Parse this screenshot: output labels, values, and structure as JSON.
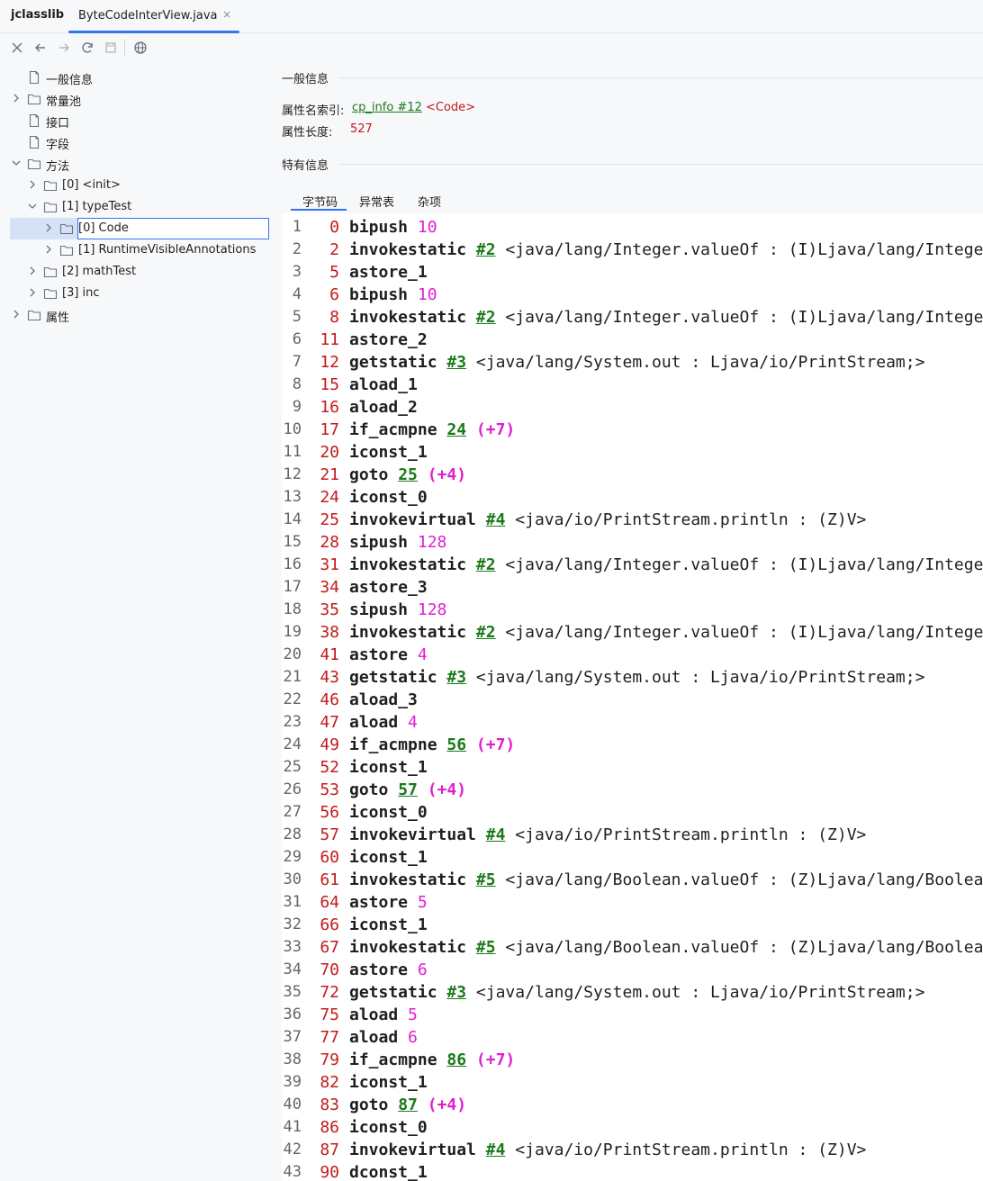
{
  "tabbar": {
    "tool_title": "jclasslib",
    "file_tab": "ByteCodeInterView.java",
    "close_glyph": "×"
  },
  "toolbar": {
    "icons": [
      "close-icon",
      "back-icon",
      "forward-icon",
      "refresh-icon",
      "save-icon",
      "web-icon"
    ]
  },
  "tree": [
    {
      "label": "一般信息",
      "expandable": false,
      "expanded": false,
      "icon": "file-icon",
      "level": 0
    },
    {
      "label": "常量池",
      "expandable": true,
      "expanded": false,
      "icon": "folder-icon",
      "level": 0
    },
    {
      "label": "接口",
      "expandable": false,
      "expanded": false,
      "icon": "file-icon",
      "level": 0
    },
    {
      "label": "字段",
      "expandable": false,
      "expanded": false,
      "icon": "file-icon",
      "level": 0
    },
    {
      "label": "方法",
      "expandable": true,
      "expanded": true,
      "icon": "folder-icon",
      "level": 0
    },
    {
      "label": "[0] <init>",
      "expandable": true,
      "expanded": false,
      "icon": "folder-icon",
      "level": 1
    },
    {
      "label": "[1] typeTest",
      "expandable": true,
      "expanded": true,
      "icon": "folder-icon",
      "level": 1
    },
    {
      "label": "[0] Code",
      "expandable": true,
      "expanded": false,
      "icon": "folder-icon",
      "level": 2,
      "selected": true
    },
    {
      "label": "[1] RuntimeVisibleAnnotations",
      "expandable": true,
      "expanded": false,
      "icon": "folder-icon",
      "level": 2
    },
    {
      "label": "[2] mathTest",
      "expandable": true,
      "expanded": false,
      "icon": "folder-icon",
      "level": 1
    },
    {
      "label": "[3] inc",
      "expandable": true,
      "expanded": false,
      "icon": "folder-icon",
      "level": 1
    },
    {
      "label": "属性",
      "expandable": true,
      "expanded": false,
      "icon": "folder-icon",
      "level": 0
    }
  ],
  "general": {
    "heading": "一般信息",
    "attr_name_index_label": "属性名索引:",
    "attr_name_index_link": "cp_info #12",
    "attr_name_index_value": "<Code>",
    "attr_length_label": "属性长度:",
    "attr_length_value": "527"
  },
  "specific": {
    "heading": "特有信息",
    "tabs": [
      "字节码",
      "异常表",
      "杂项"
    ],
    "active_tab": 0
  },
  "colors": {
    "accent": "#3574f0",
    "offset": "#c41a1a",
    "constant": "#e020d0",
    "reference": "#1a7a1a"
  },
  "bytecode": [
    {
      "ln": "1",
      "off": "0",
      "op": "bipush",
      "num": "10"
    },
    {
      "ln": "2",
      "off": "2",
      "op": "invokestatic",
      "ref": "#2",
      "cmt": "<java/lang/Integer.valueOf : (I)Ljava/lang/Integer;>"
    },
    {
      "ln": "3",
      "off": "5",
      "op": "astore_1"
    },
    {
      "ln": "4",
      "off": "6",
      "op": "bipush",
      "num": "10"
    },
    {
      "ln": "5",
      "off": "8",
      "op": "invokestatic",
      "ref": "#2",
      "cmt": "<java/lang/Integer.valueOf : (I)Ljava/lang/Integer;>"
    },
    {
      "ln": "6",
      "off": "11",
      "op": "astore_2"
    },
    {
      "ln": "7",
      "off": "12",
      "op": "getstatic",
      "ref": "#3",
      "cmt": "<java/lang/System.out : Ljava/io/PrintStream;>"
    },
    {
      "ln": "8",
      "off": "15",
      "op": "aload_1"
    },
    {
      "ln": "9",
      "off": "16",
      "op": "aload_2"
    },
    {
      "ln": "10",
      "off": "17",
      "op": "if_acmpne",
      "ref": "24",
      "rel": "(+7)"
    },
    {
      "ln": "11",
      "off": "20",
      "op": "iconst_1"
    },
    {
      "ln": "12",
      "off": "21",
      "op": "goto",
      "ref": "25",
      "rel": "(+4)"
    },
    {
      "ln": "13",
      "off": "24",
      "op": "iconst_0"
    },
    {
      "ln": "14",
      "off": "25",
      "op": "invokevirtual",
      "ref": "#4",
      "cmt": "<java/io/PrintStream.println : (Z)V>"
    },
    {
      "ln": "15",
      "off": "28",
      "op": "sipush",
      "num": "128"
    },
    {
      "ln": "16",
      "off": "31",
      "op": "invokestatic",
      "ref": "#2",
      "cmt": "<java/lang/Integer.valueOf : (I)Ljava/lang/Integer;>"
    },
    {
      "ln": "17",
      "off": "34",
      "op": "astore_3"
    },
    {
      "ln": "18",
      "off": "35",
      "op": "sipush",
      "num": "128"
    },
    {
      "ln": "19",
      "off": "38",
      "op": "invokestatic",
      "ref": "#2",
      "cmt": "<java/lang/Integer.valueOf : (I)Ljava/lang/Integer;>"
    },
    {
      "ln": "20",
      "off": "41",
      "op": "astore",
      "num": "4"
    },
    {
      "ln": "21",
      "off": "43",
      "op": "getstatic",
      "ref": "#3",
      "cmt": "<java/lang/System.out : Ljava/io/PrintStream;>"
    },
    {
      "ln": "22",
      "off": "46",
      "op": "aload_3"
    },
    {
      "ln": "23",
      "off": "47",
      "op": "aload",
      "num": "4"
    },
    {
      "ln": "24",
      "off": "49",
      "op": "if_acmpne",
      "ref": "56",
      "rel": "(+7)"
    },
    {
      "ln": "25",
      "off": "52",
      "op": "iconst_1"
    },
    {
      "ln": "26",
      "off": "53",
      "op": "goto",
      "ref": "57",
      "rel": "(+4)"
    },
    {
      "ln": "27",
      "off": "56",
      "op": "iconst_0"
    },
    {
      "ln": "28",
      "off": "57",
      "op": "invokevirtual",
      "ref": "#4",
      "cmt": "<java/io/PrintStream.println : (Z)V>"
    },
    {
      "ln": "29",
      "off": "60",
      "op": "iconst_1"
    },
    {
      "ln": "30",
      "off": "61",
      "op": "invokestatic",
      "ref": "#5",
      "cmt": "<java/lang/Boolean.valueOf : (Z)Ljava/lang/Boolean;>"
    },
    {
      "ln": "31",
      "off": "64",
      "op": "astore",
      "num": "5"
    },
    {
      "ln": "32",
      "off": "66",
      "op": "iconst_1"
    },
    {
      "ln": "33",
      "off": "67",
      "op": "invokestatic",
      "ref": "#5",
      "cmt": "<java/lang/Boolean.valueOf : (Z)Ljava/lang/Boolean;>"
    },
    {
      "ln": "34",
      "off": "70",
      "op": "astore",
      "num": "6"
    },
    {
      "ln": "35",
      "off": "72",
      "op": "getstatic",
      "ref": "#3",
      "cmt": "<java/lang/System.out : Ljava/io/PrintStream;>"
    },
    {
      "ln": "36",
      "off": "75",
      "op": "aload",
      "num": "5"
    },
    {
      "ln": "37",
      "off": "77",
      "op": "aload",
      "num": "6"
    },
    {
      "ln": "38",
      "off": "79",
      "op": "if_acmpne",
      "ref": "86",
      "rel": "(+7)"
    },
    {
      "ln": "39",
      "off": "82",
      "op": "iconst_1"
    },
    {
      "ln": "40",
      "off": "83",
      "op": "goto",
      "ref": "87",
      "rel": "(+4)"
    },
    {
      "ln": "41",
      "off": "86",
      "op": "iconst_0"
    },
    {
      "ln": "42",
      "off": "87",
      "op": "invokevirtual",
      "ref": "#4",
      "cmt": "<java/io/PrintStream.println : (Z)V>"
    },
    {
      "ln": "43",
      "off": "90",
      "op": "dconst_1"
    }
  ]
}
